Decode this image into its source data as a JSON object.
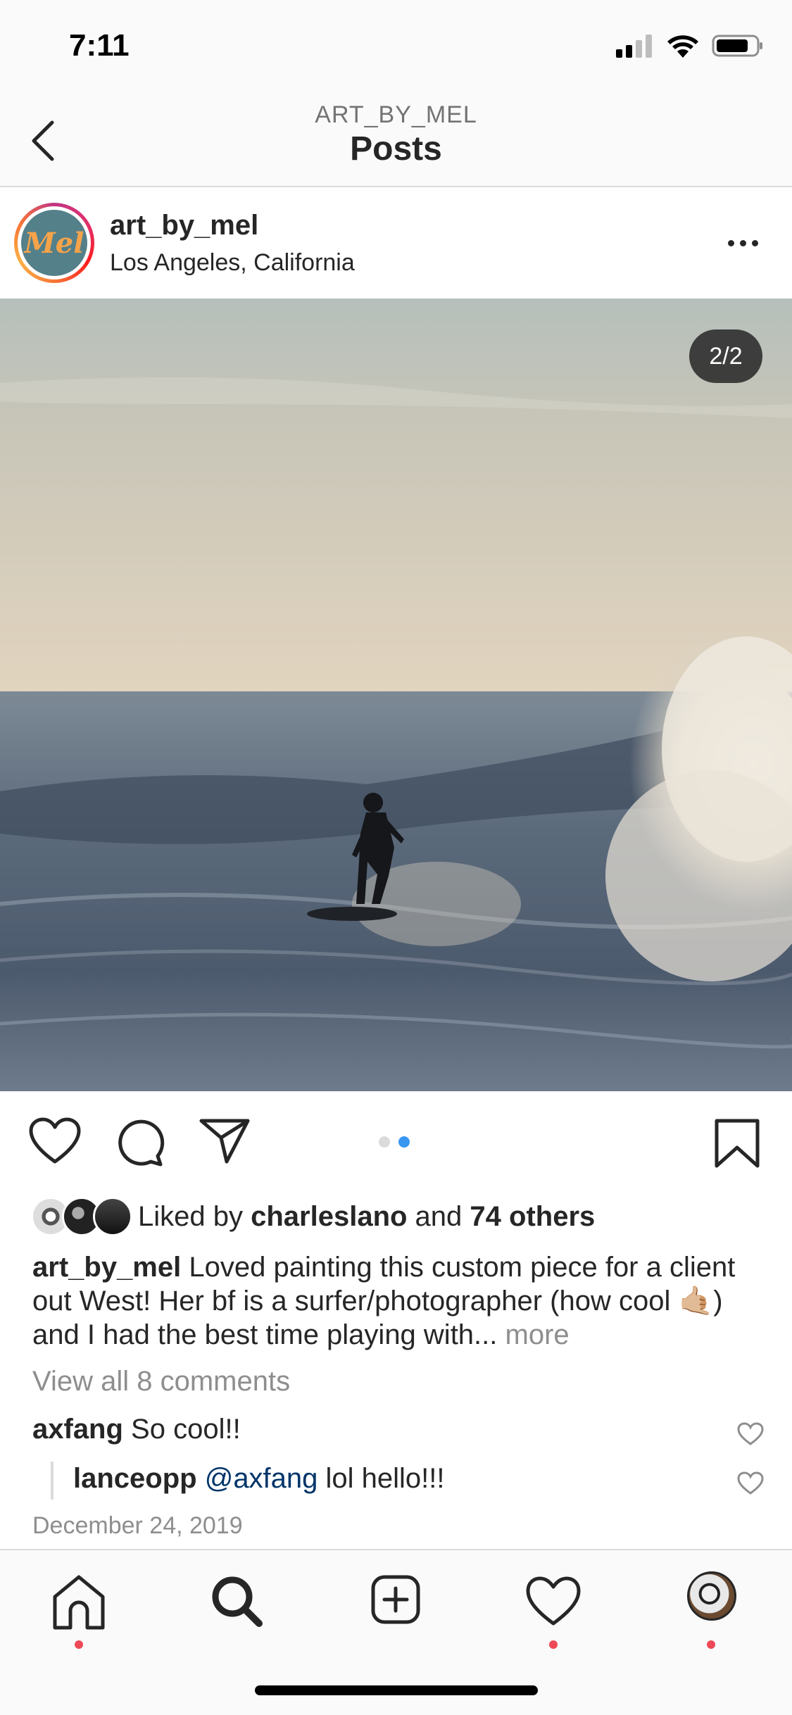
{
  "status_bar": {
    "time": "7:11"
  },
  "header": {
    "subtitle": "ART_BY_MEL",
    "title": "Posts"
  },
  "post": {
    "avatar_text": "Mel",
    "username": "art_by_mel",
    "location": "Los Angeles, California",
    "image_counter": "2/2",
    "carousel": {
      "total": 2,
      "active_index": 2
    }
  },
  "likes": {
    "prefix": "Liked by ",
    "user": "charleslano",
    "middle": " and ",
    "others": "74 others"
  },
  "caption": {
    "username": "art_by_mel",
    "text_1": " Loved painting this custom piece for a client out West! Her bf is a surfer/photographer (how cool ",
    "emoji": "🤙🏼",
    "text_2": ") and I had the best time playing with...",
    "more": " more"
  },
  "view_all_comments": "View all 8 comments",
  "comments": [
    {
      "username": "axfang",
      "text": " So cool!!"
    },
    {
      "username": "lanceopp",
      "mention": " @axfang",
      "text": " lol hello!!!"
    }
  ],
  "date": "December 24, 2019",
  "colors": {
    "accent_blue": "#3897f0",
    "notification_red": "#ed4956",
    "text_primary": "#262626",
    "text_secondary": "#8e8e8e"
  },
  "tab_bar": {
    "tabs": [
      "home-icon",
      "search-icon",
      "new-post-icon",
      "activity-heart-icon",
      "profile-avatar"
    ]
  }
}
